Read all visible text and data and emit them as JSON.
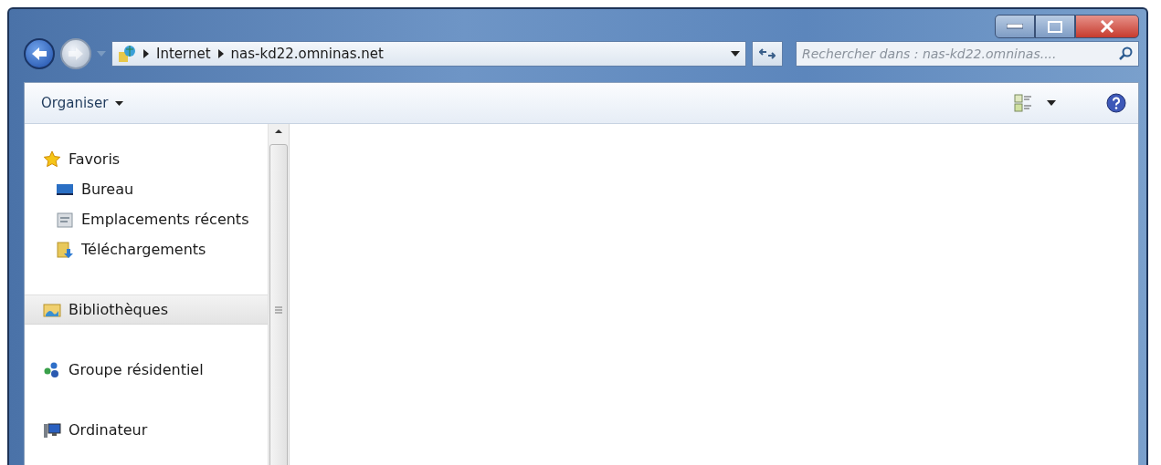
{
  "address_bar": {
    "breadcrumbs": [
      "Internet",
      "nas-kd22.omninas.net"
    ]
  },
  "search": {
    "placeholder": "Rechercher dans : nas-kd22.omninas...."
  },
  "toolbar": {
    "organize": "Organiser"
  },
  "navigation": {
    "groups": [
      {
        "label": "Favoris",
        "kind": "star",
        "selected": false,
        "children": [
          {
            "label": "Bureau",
            "kind": "desktop",
            "selected": false
          },
          {
            "label": "Emplacements récents",
            "kind": "recent",
            "selected": false
          },
          {
            "label": "Téléchargements",
            "kind": "downloads",
            "selected": false
          }
        ]
      },
      {
        "label": "Bibliothèques",
        "kind": "library",
        "selected": true
      },
      {
        "label": "Groupe résidentiel",
        "kind": "homegroup",
        "selected": false
      },
      {
        "label": "Ordinateur",
        "kind": "computer",
        "selected": false
      }
    ]
  }
}
